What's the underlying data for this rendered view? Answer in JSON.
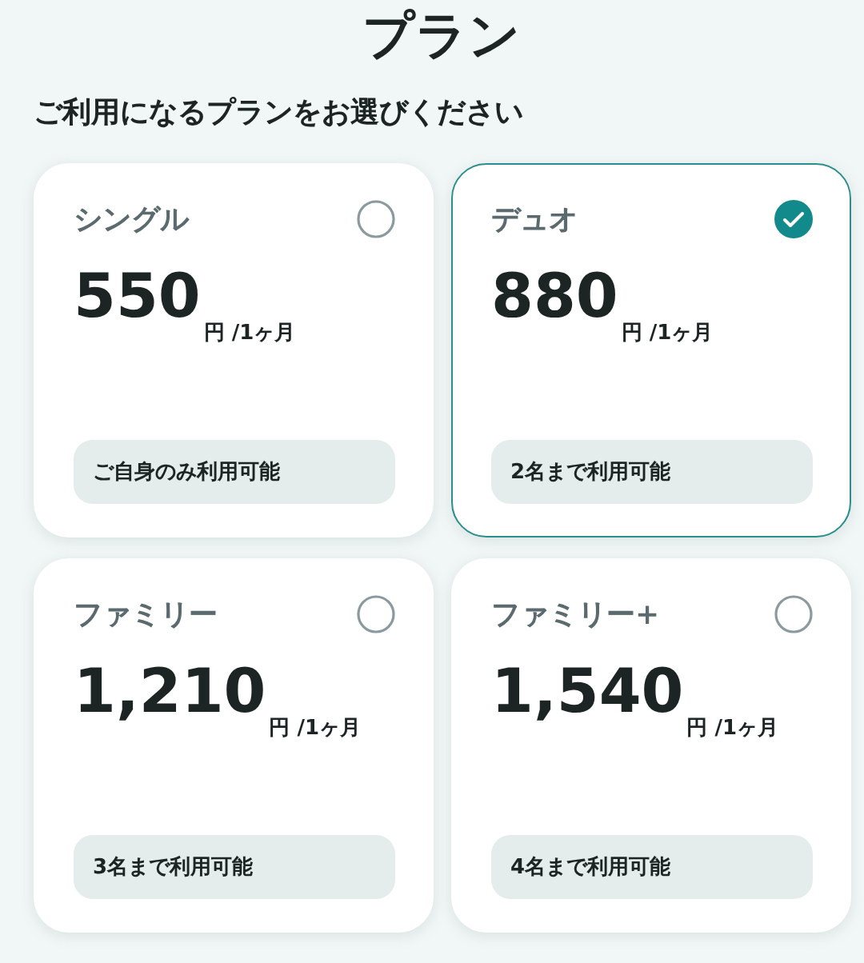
{
  "title": "プラン",
  "subtitle": "ご利用になるプランをお選びください",
  "plans": [
    {
      "name": "シングル",
      "price": "550",
      "unit": "円 /1ヶ月",
      "note": "ご自身のみ利用可能",
      "selected": false
    },
    {
      "name": "デュオ",
      "price": "880",
      "unit": "円 /1ヶ月",
      "note": "2名まで利用可能",
      "selected": true
    },
    {
      "name": "ファミリー",
      "price": "1,210",
      "unit": "円 /1ヶ月",
      "note": "3名まで利用可能",
      "selected": false
    },
    {
      "name": "ファミリー+",
      "price": "1,540",
      "unit": "円 /1ヶ月",
      "note": "4名まで利用可能",
      "selected": false
    }
  ]
}
